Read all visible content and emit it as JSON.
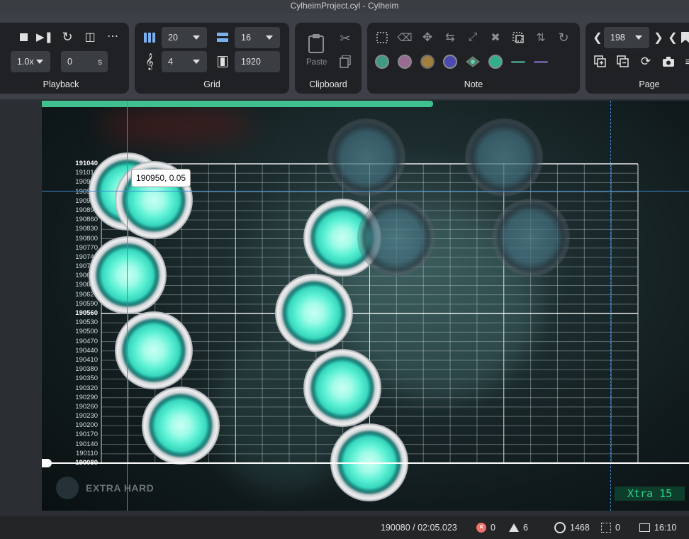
{
  "window": {
    "title": "CylheimProject.cyl - Cylheim"
  },
  "playback": {
    "speed": "1.0x",
    "offset_value": "0",
    "offset_unit": "s",
    "label": "Playback"
  },
  "grid": {
    "columns": "20",
    "rows": "16",
    "beats": "4",
    "resolution": "1920",
    "label": "Grid"
  },
  "clipboard": {
    "paste": "Paste",
    "label": "Clipboard"
  },
  "note": {
    "label": "Note"
  },
  "page": {
    "number": "198",
    "label": "Page"
  },
  "canvas": {
    "tooltip": "190950, 0.05",
    "difficulty": "EXTRA HARD",
    "level": "Xtra 15",
    "progress_fraction": 0.605,
    "ticks": [
      "191040",
      "191010",
      "190980",
      "190950",
      "190920",
      "190890",
      "190860",
      "190830",
      "190800",
      "190770",
      "190740",
      "190710",
      "190680",
      "190650",
      "190620",
      "190590",
      "190560",
      "190530",
      "190500",
      "190470",
      "190440",
      "190410",
      "190380",
      "190350",
      "190320",
      "190290",
      "190260",
      "190230",
      "190200",
      "190170",
      "190140",
      "190110",
      "190080"
    ]
  },
  "status": {
    "position": "190080 / 02:05.023",
    "errors": "0",
    "warnings": "6",
    "notes": "1468",
    "grid_count": "0",
    "time": "16:10"
  },
  "colors": {
    "accent": "#3fc08e",
    "note_core": "#5ff2d6",
    "crosshair": "#3a8bd6"
  }
}
